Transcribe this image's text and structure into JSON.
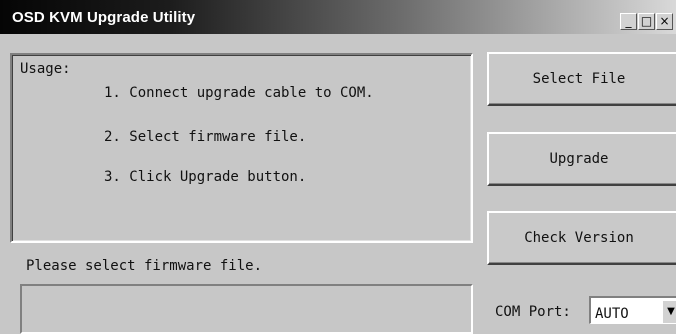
{
  "window": {
    "title": "OSD KVM Upgrade Utility",
    "controls": [
      "_",
      "□",
      "×"
    ]
  },
  "usage": {
    "heading": "Usage:",
    "steps": [
      "1. Connect upgrade cable to COM.",
      "2. Select firmware file.",
      "3. Click Upgrade button."
    ]
  },
  "status_text": "Please select firmware file.",
  "buttons": {
    "select_file": "Select File",
    "upgrade": "Upgrade",
    "check_version": "Check Version"
  },
  "com_port": {
    "label": "COM Port:",
    "value": "AUTO"
  }
}
